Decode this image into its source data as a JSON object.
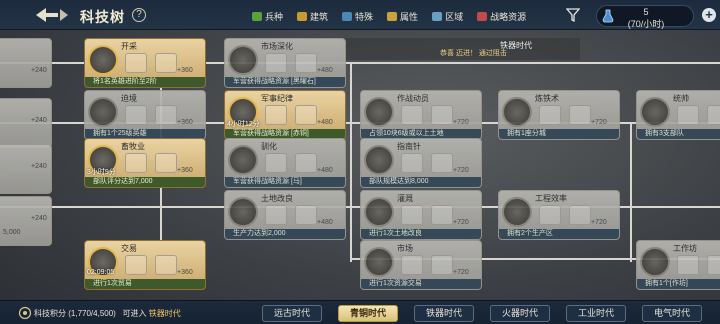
{
  "header": {
    "title": "科技树",
    "help": "?",
    "legend": [
      {
        "label": "兵种",
        "color": "#5aa33a"
      },
      {
        "label": "建筑",
        "color": "#c99a2e"
      },
      {
        "label": "特殊",
        "color": "#4b8ab5"
      },
      {
        "label": "属性",
        "color": "#caa43a"
      },
      {
        "label": "区域",
        "color": "#6a9fc2"
      },
      {
        "label": "战略资源",
        "color": "#c24a4a"
      }
    ],
    "resource": {
      "value": "5",
      "rate": "(70/小时)"
    }
  },
  "era_notice": {
    "label": "铁器时代",
    "message": "恭喜 迈进！ 通过阻击"
  },
  "nodes": [
    {
      "id": "n1",
      "name": "开采",
      "req": "将1名英雄进阶至2阶",
      "plus": "+360",
      "type": "active"
    },
    {
      "id": "n2",
      "name": "市场深化",
      "req": "军营获得战略资源 [黑曜石]",
      "plus": "+480",
      "type": "dim"
    },
    {
      "id": "n3",
      "name": "迫境",
      "req": "拥有1个25级英雄",
      "plus": "+360",
      "type": "dim"
    },
    {
      "id": "n4",
      "name": "军事纪律",
      "req": "军营获得战略资源 [赤铜]",
      "plus": "+480",
      "timer": "4小时12分",
      "type": "active"
    },
    {
      "id": "n5",
      "name": "作战动员",
      "req": "占领10块6级或以上土地",
      "plus": "+720",
      "type": "dim"
    },
    {
      "id": "n6",
      "name": "炼铁术",
      "req": "拥有1座分城",
      "plus": "+720",
      "type": "dim"
    },
    {
      "id": "n7",
      "name": "统帅",
      "req": "拥有3支部队",
      "plus": "+720",
      "type": "dim"
    },
    {
      "id": "n8",
      "name": "畜牧业",
      "req": "部队评分达到7,000",
      "plus": "+360",
      "timer": "3小时9分",
      "type": "active"
    },
    {
      "id": "n9",
      "name": "驯化",
      "req": "军营获得战略资源 [马]",
      "plus": "+480",
      "type": "dim"
    },
    {
      "id": "n10",
      "name": "指南针",
      "req": "部队规模达到8,000",
      "plus": "+720",
      "type": "dim"
    },
    {
      "id": "n11",
      "name": "土地改良",
      "req": "生产力达到2,000",
      "plus": "+480",
      "type": "dim"
    },
    {
      "id": "n12",
      "name": "灌溉",
      "req": "进行1次土地改良",
      "plus": "+720",
      "type": "dim"
    },
    {
      "id": "n13",
      "name": "工程效率",
      "req": "拥有2个生产区",
      "plus": "+720",
      "type": "dim"
    },
    {
      "id": "n14",
      "name": "交易",
      "req": "进行1次贸易",
      "plus": "+360",
      "timer": "02:09:05",
      "type": "active"
    },
    {
      "id": "n15",
      "name": "市场",
      "req": "进行1次资源交易",
      "plus": "+720",
      "type": "dim"
    },
    {
      "id": "n16",
      "name": "工作坊",
      "req": "拥有1个[作坊]",
      "plus": "",
      "type": "dim"
    }
  ],
  "left_partial": {
    "plus": "+240",
    "value": "5,000"
  },
  "footer": {
    "score_label": "科技积分",
    "score_value": "(1,770/4,500)",
    "enter_label": "可进入",
    "enter_era": "铁器时代",
    "eras": [
      "远古时代",
      "青铜时代",
      "铁器时代",
      "火器时代",
      "工业时代",
      "电气时代"
    ],
    "selected_era": "青铜时代"
  }
}
